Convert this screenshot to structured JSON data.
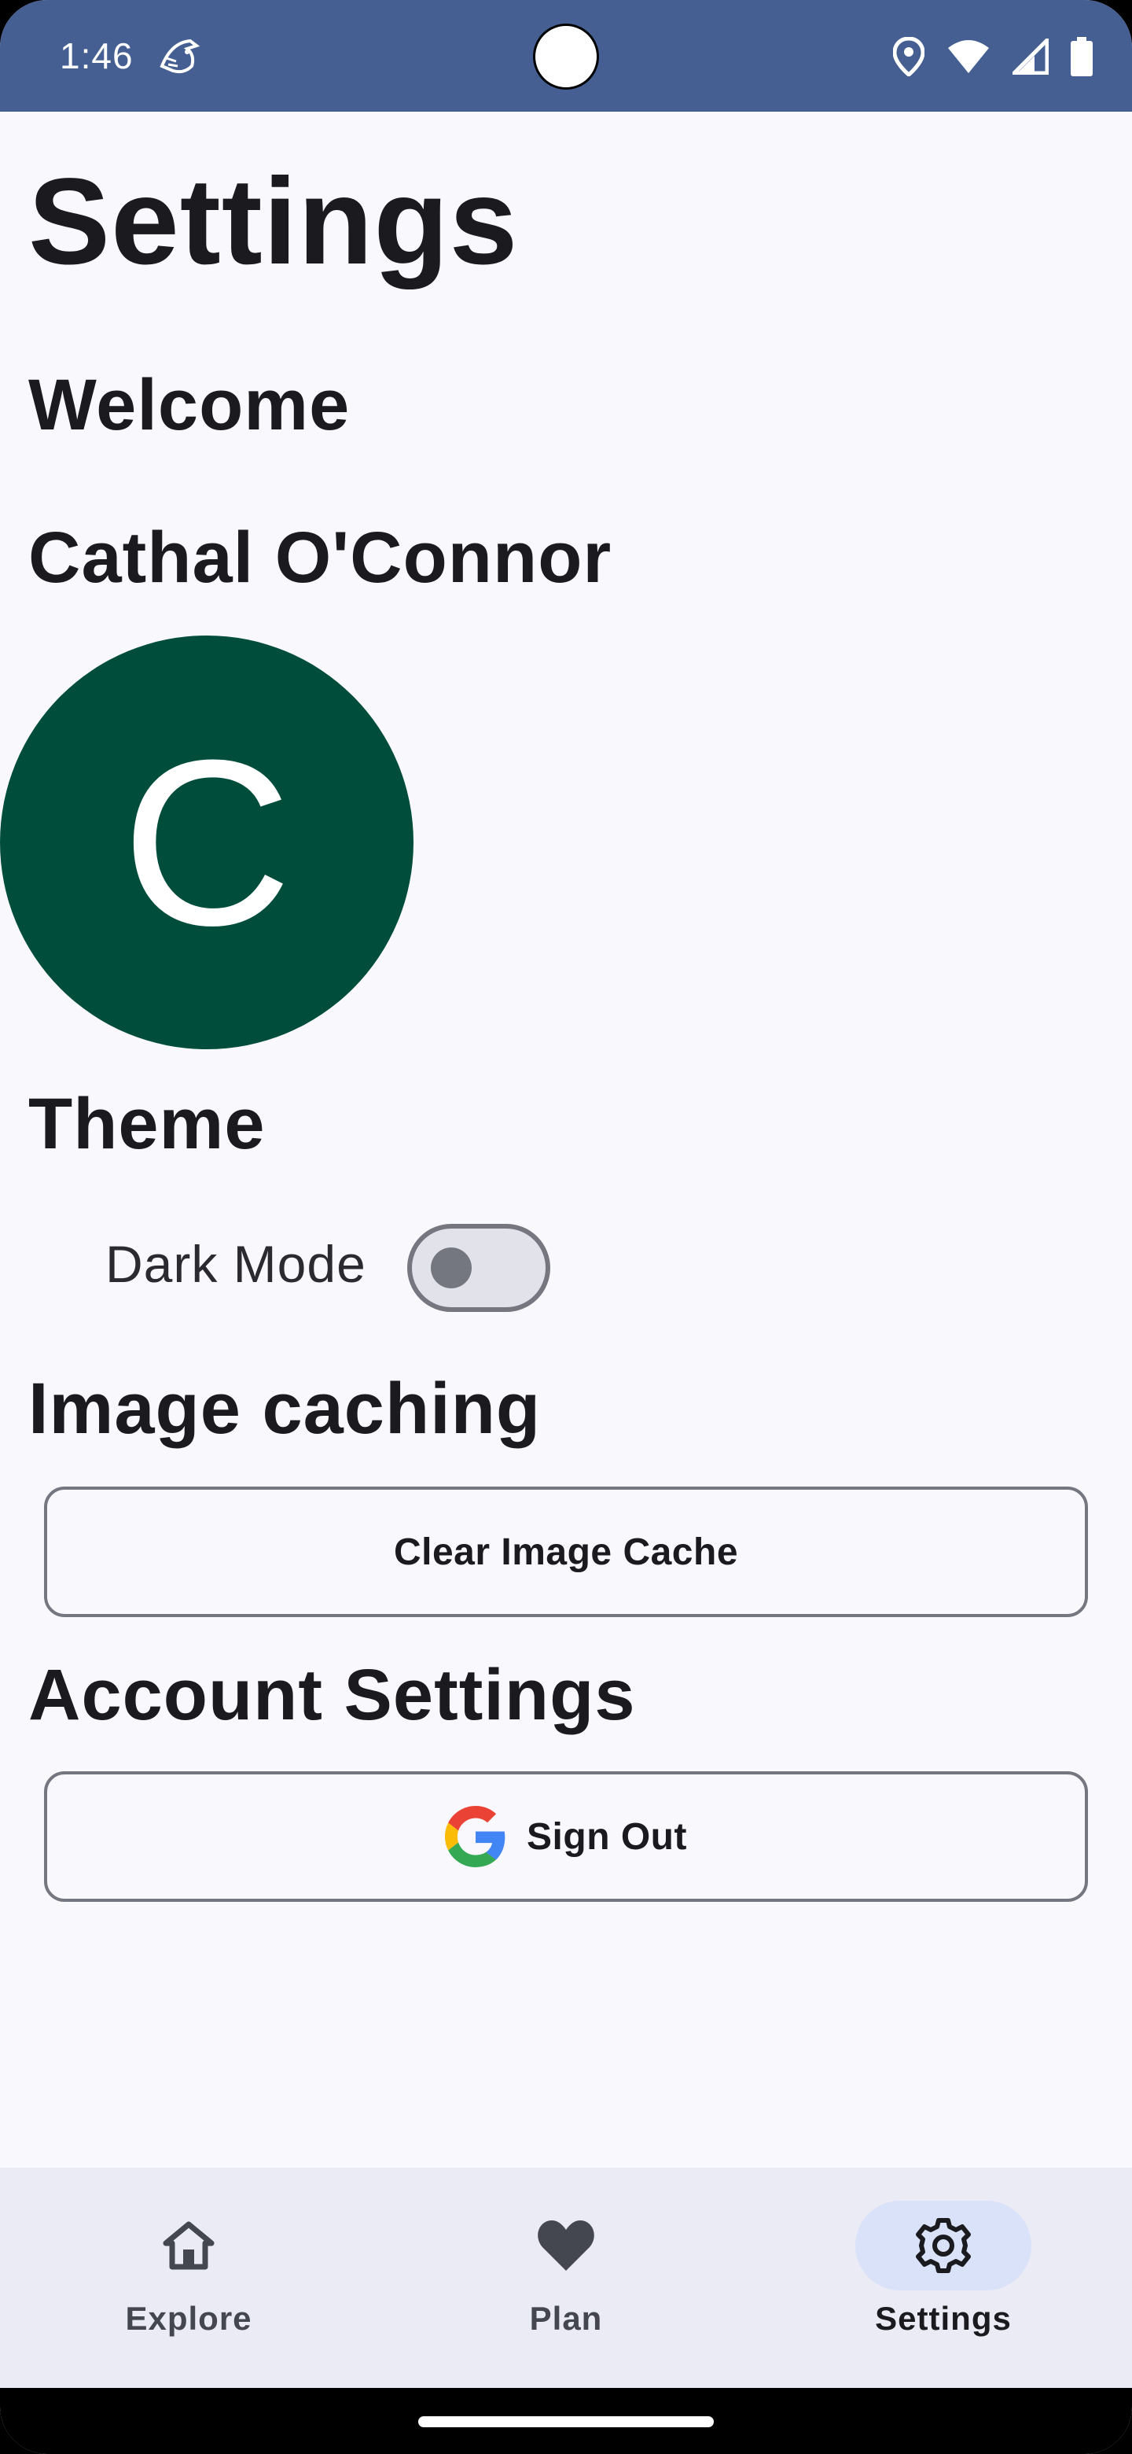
{
  "status_bar": {
    "time": "1:46",
    "icons": [
      "app-notification-icon",
      "location-icon",
      "wifi-icon",
      "signal-icon",
      "battery-icon"
    ],
    "background": "#455f93"
  },
  "page": {
    "title": "Settings",
    "welcome": "Welcome",
    "user_name": "Cathal O'Connor",
    "avatar_initial": "C",
    "avatar_color": "#004d3c"
  },
  "theme": {
    "heading": "Theme",
    "dark_mode_label": "Dark Mode",
    "dark_mode_on": false
  },
  "image_caching": {
    "heading": "Image caching",
    "clear_button": "Clear Image Cache"
  },
  "account": {
    "heading": "Account Settings",
    "sign_out_button": "Sign Out",
    "sign_out_icon": "google-icon"
  },
  "bottom_nav": {
    "items": [
      {
        "label": "Explore",
        "icon": "home-icon",
        "active": false
      },
      {
        "label": "Plan",
        "icon": "heart-icon",
        "active": false
      },
      {
        "label": "Settings",
        "icon": "gear-icon",
        "active": true
      }
    ],
    "active_color": "#dae2fa"
  }
}
